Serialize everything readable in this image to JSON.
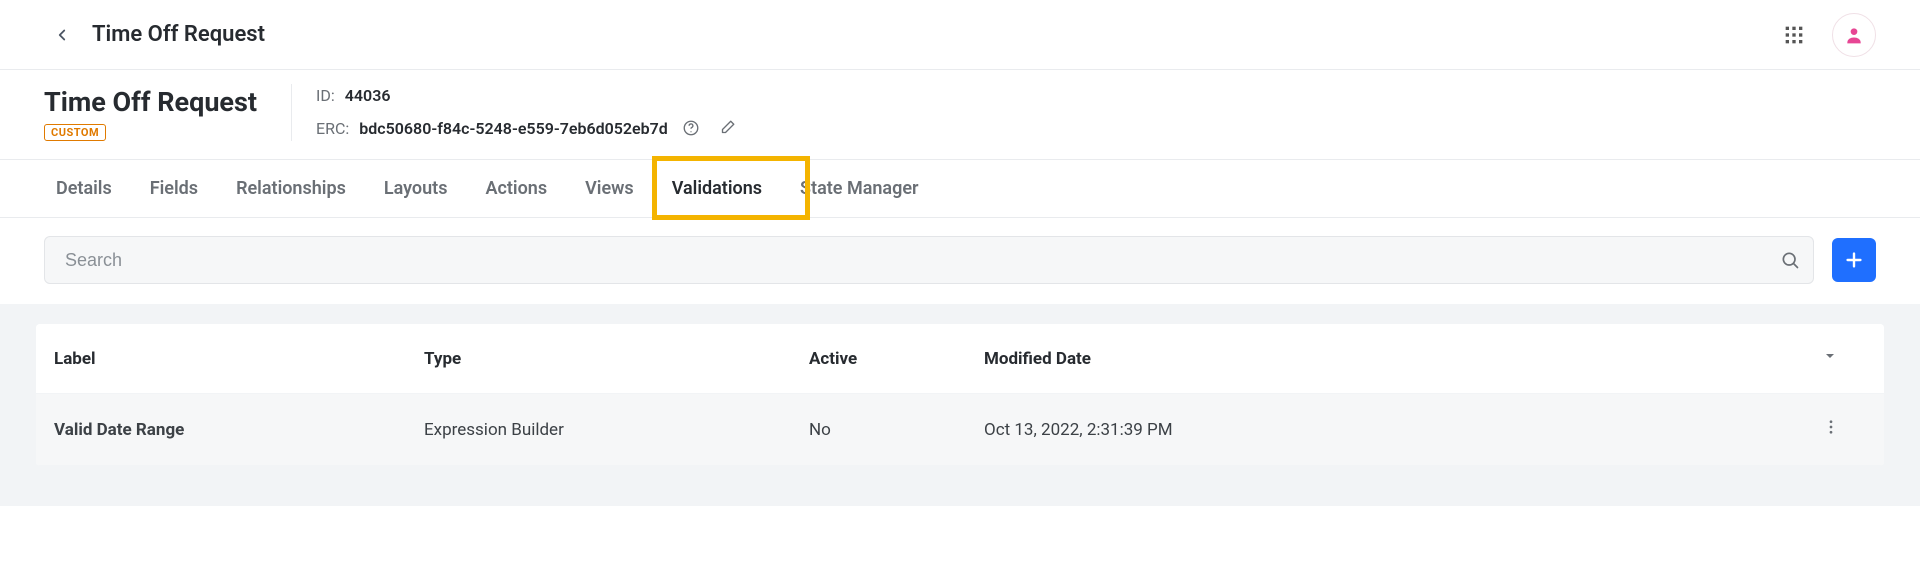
{
  "topbar": {
    "title": "Time Off Request"
  },
  "meta": {
    "object_name": "Time Off Request",
    "badge": "CUSTOM",
    "id_label": "ID:",
    "id_value": "44036",
    "erc_label": "ERC:",
    "erc_value": "bdc50680-f84c-5248-e559-7eb6d052eb7d"
  },
  "tabs": [
    {
      "label": "Details",
      "active": false
    },
    {
      "label": "Fields",
      "active": false
    },
    {
      "label": "Relationships",
      "active": false
    },
    {
      "label": "Layouts",
      "active": false
    },
    {
      "label": "Actions",
      "active": false
    },
    {
      "label": "Views",
      "active": false
    },
    {
      "label": "Validations",
      "active": true
    },
    {
      "label": "State Manager",
      "active": false
    }
  ],
  "search": {
    "placeholder": "Search"
  },
  "table": {
    "headers": {
      "label": "Label",
      "type": "Type",
      "active": "Active",
      "modified": "Modified Date"
    },
    "rows": [
      {
        "label": "Valid Date Range",
        "type": "Expression Builder",
        "active": "No",
        "modified": "Oct 13, 2022, 2:31:39 PM"
      }
    ]
  }
}
